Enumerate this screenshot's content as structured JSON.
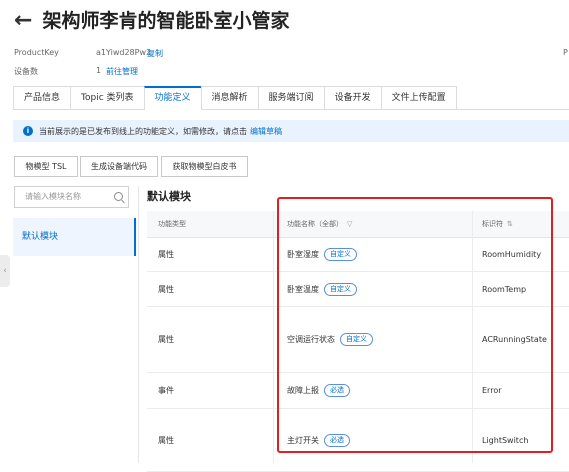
{
  "header": {
    "back_icon": "arrow-left-icon",
    "title": "架构师李肯的智能卧室小管家"
  },
  "meta": {
    "product_key_label": "ProductKey",
    "product_key_value": "a1Yiwd28Pw2",
    "copy_label": "复制",
    "right_edge_label": "P",
    "device_count_label": "设备数",
    "device_count_value": "1",
    "manage_label": "前往管理"
  },
  "tabs": [
    {
      "label": "产品信息"
    },
    {
      "label": "Topic 类列表"
    },
    {
      "label": "功能定义",
      "active": true
    },
    {
      "label": "消息解析"
    },
    {
      "label": "服务端订阅"
    },
    {
      "label": "设备开发"
    },
    {
      "label": "文件上传配置"
    }
  ],
  "notice": {
    "text": "当前展示的是已发布到线上的功能定义，如需修改，请点击",
    "link": "编辑草稿"
  },
  "toolbar": {
    "tsl": "物模型 TSL",
    "gen_code": "生成设备端代码",
    "whitepaper": "获取物模型白皮书"
  },
  "sidebar": {
    "search_placeholder": "请输入模块名称",
    "items": [
      {
        "label": "默认模块"
      }
    ]
  },
  "section": {
    "title": "默认模块"
  },
  "table": {
    "headers": {
      "type": "功能类型",
      "name": "功能名称（全部）",
      "identifier": "标识符"
    },
    "rows": [
      {
        "type": "属性",
        "name": "卧室湿度",
        "badge": "自定义",
        "identifier": "RoomHumidity"
      },
      {
        "type": "属性",
        "name": "卧室温度",
        "badge": "自定义",
        "identifier": "RoomTemp"
      },
      {
        "type": "属性",
        "name": "空调运行状态",
        "badge": "自定义",
        "identifier": "ACRunningState"
      },
      {
        "type": "事件",
        "name": "故障上报",
        "badge": "必选",
        "identifier": "Error"
      },
      {
        "type": "属性",
        "name": "主灯开关",
        "badge": "必选",
        "identifier": "LightSwitch"
      }
    ]
  },
  "colors": {
    "accent": "#0070cc",
    "highlight": "#e02020",
    "notice_bg": "#e8f3ff"
  }
}
